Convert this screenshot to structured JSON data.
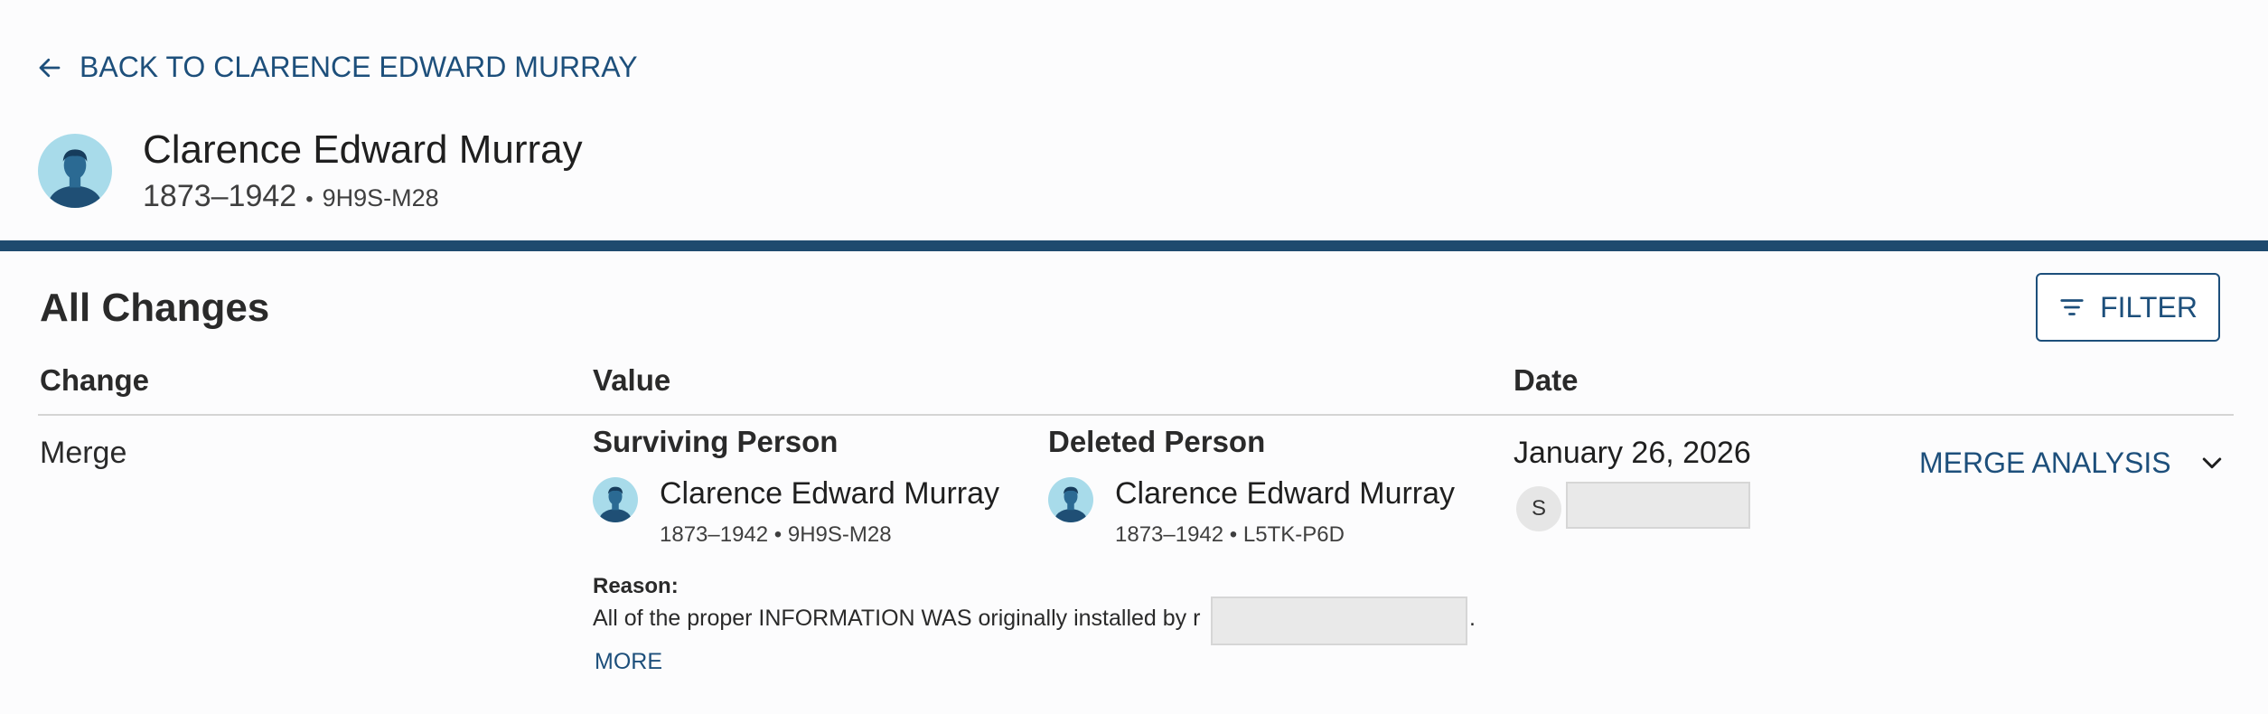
{
  "header": {
    "back_label": "BACK TO CLARENCE EDWARD MURRAY",
    "person": {
      "name": "Clarence Edward Murray",
      "years": "1873–1942",
      "separator": "•",
      "pid": "9H9S-M28"
    }
  },
  "section": {
    "title": "All Changes",
    "filter_label": "FILTER"
  },
  "table": {
    "columns": [
      "Change",
      "Value",
      "Date"
    ],
    "rows": [
      {
        "change": "Merge",
        "surviving": {
          "label": "Surviving Person",
          "name": "Clarence Edward Murray",
          "meta": "1873–1942 • 9H9S-M28"
        },
        "deleted": {
          "label": "Deleted Person",
          "name": "Clarence Edward Murray",
          "meta": "1873–1942 • L5TK-P6D"
        },
        "reason_label": "Reason:",
        "reason_text": "All of the proper INFORMATION WAS originally installed by r",
        "reason_end": ".",
        "more_label": "MORE",
        "date": "January 26, 2026",
        "contributor_initial": "S",
        "merge_analysis_label": "MERGE ANALYSIS"
      }
    ]
  },
  "colors": {
    "accent": "#1d4f7b",
    "divider": "#1e4a6e",
    "avatar_bg": "#a8dbea",
    "avatar_figure": "#1f4f75"
  },
  "icons": {
    "back": "arrow-left-icon",
    "filter": "filter-lines-icon",
    "expand": "chevron-down-icon",
    "avatar": "person-silhouette-icon"
  }
}
